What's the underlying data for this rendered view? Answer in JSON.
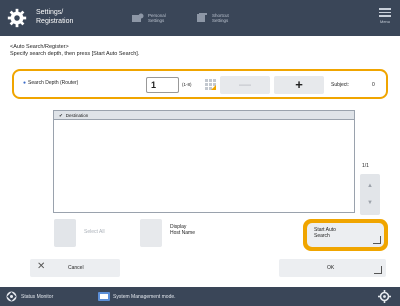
{
  "header": {
    "title_line1": "Settings/",
    "title_line2": "Registration",
    "btn1_line1": "Personal",
    "btn1_line2": "Settings",
    "btn2_line1": "Shortcut",
    "btn2_line2": "Settings",
    "menu_label": "Menu"
  },
  "instructions": {
    "line1": "<Auto Search/Register>",
    "line2": "Specify search depth, then press [Start Auto Search]."
  },
  "depth": {
    "label": "Search Depth (Router)",
    "value": "1",
    "range": "(1-8)",
    "minus": "—",
    "plus": "+",
    "subject_label": "Subject:",
    "subject_count": "0"
  },
  "destination": {
    "header": "Destination",
    "page": "1/1",
    "up": "▲",
    "down": "▼"
  },
  "controls": {
    "select_all": "Select All",
    "display_line1": "Display",
    "display_line2": "Host Name",
    "start_line1": "Start Auto",
    "start_line2": "Search"
  },
  "footer": {
    "cancel_icon": "✕",
    "cancel": "Cancel",
    "ok": "OK"
  },
  "status_bar": {
    "status_monitor": "Status Monitor",
    "system_mode": "System Management mode."
  },
  "colors": {
    "header_bg": "#3a4658",
    "highlight": "#f0a500",
    "button_bg": "#eceef1"
  }
}
